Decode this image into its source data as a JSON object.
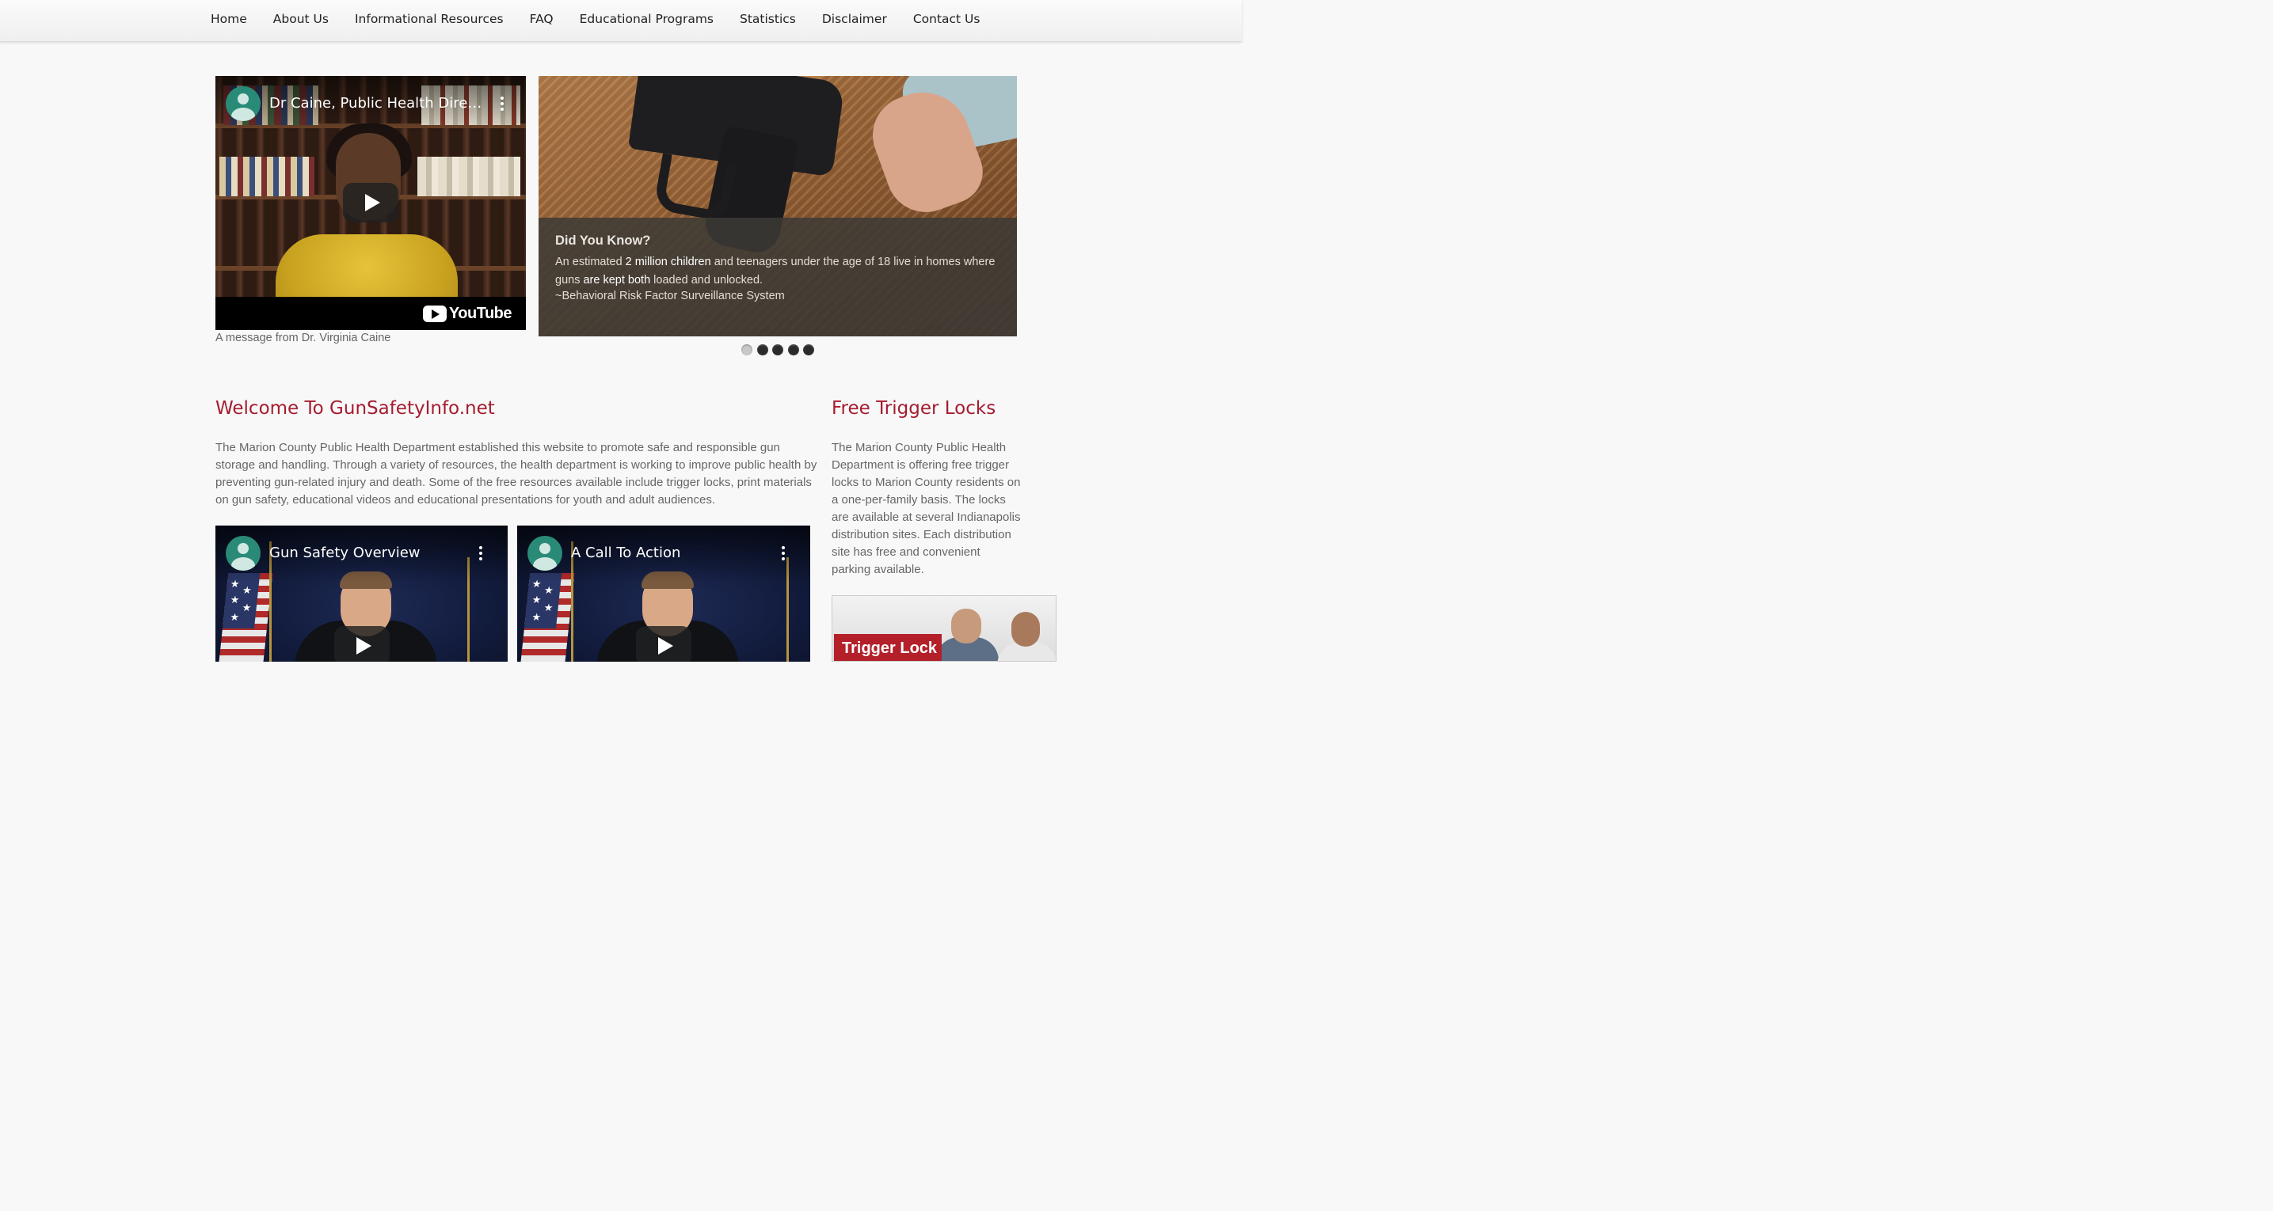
{
  "nav": {
    "items": [
      "Home",
      "About Us",
      "Informational Resources",
      "FAQ",
      "Educational Programs",
      "Statistics",
      "Disclaimer",
      "Contact Us"
    ]
  },
  "hero_video": {
    "title": "Dr Caine, Public Health Direct...",
    "brand": "YouTube",
    "caption": "A message from Dr. Virginia Caine"
  },
  "slider": {
    "heading": "Did You Know?",
    "text_parts": [
      "An estimated ",
      "2 million children",
      " and teenagers under the age of 18 live in homes where guns ",
      "are kept both",
      " loaded and unlocked."
    ],
    "source": "~Behavioral Risk Factor Surveillance System",
    "slide_count": 5,
    "active_slide": 1
  },
  "welcome": {
    "heading": "Welcome To GunSafetyInfo.net",
    "body": "The Marion County Public Health Department established this website to promote safe and responsible gun storage and handling. Through a variety of resources, the health department is working to improve public health by preventing gun-related injury and death. Some of the free resources available include trigger locks, print materials on gun safety, educational videos and educational presentations for youth and adult audiences."
  },
  "videos": [
    {
      "title": "Gun Safety Overview"
    },
    {
      "title": "A Call To Action"
    }
  ],
  "trigger_locks": {
    "heading": "Free Trigger Locks",
    "body": "The Marion County Public Health Department is offering free trigger locks to Marion County residents on a one-per-family basis. The locks are available at several Indianapolis distribution sites. Each distribution site has free and convenient parking available.",
    "thumb_label": "Trigger Lock"
  },
  "colors": {
    "heading": "#a51c30",
    "text": "#666666",
    "background": "#f8f8f8"
  }
}
